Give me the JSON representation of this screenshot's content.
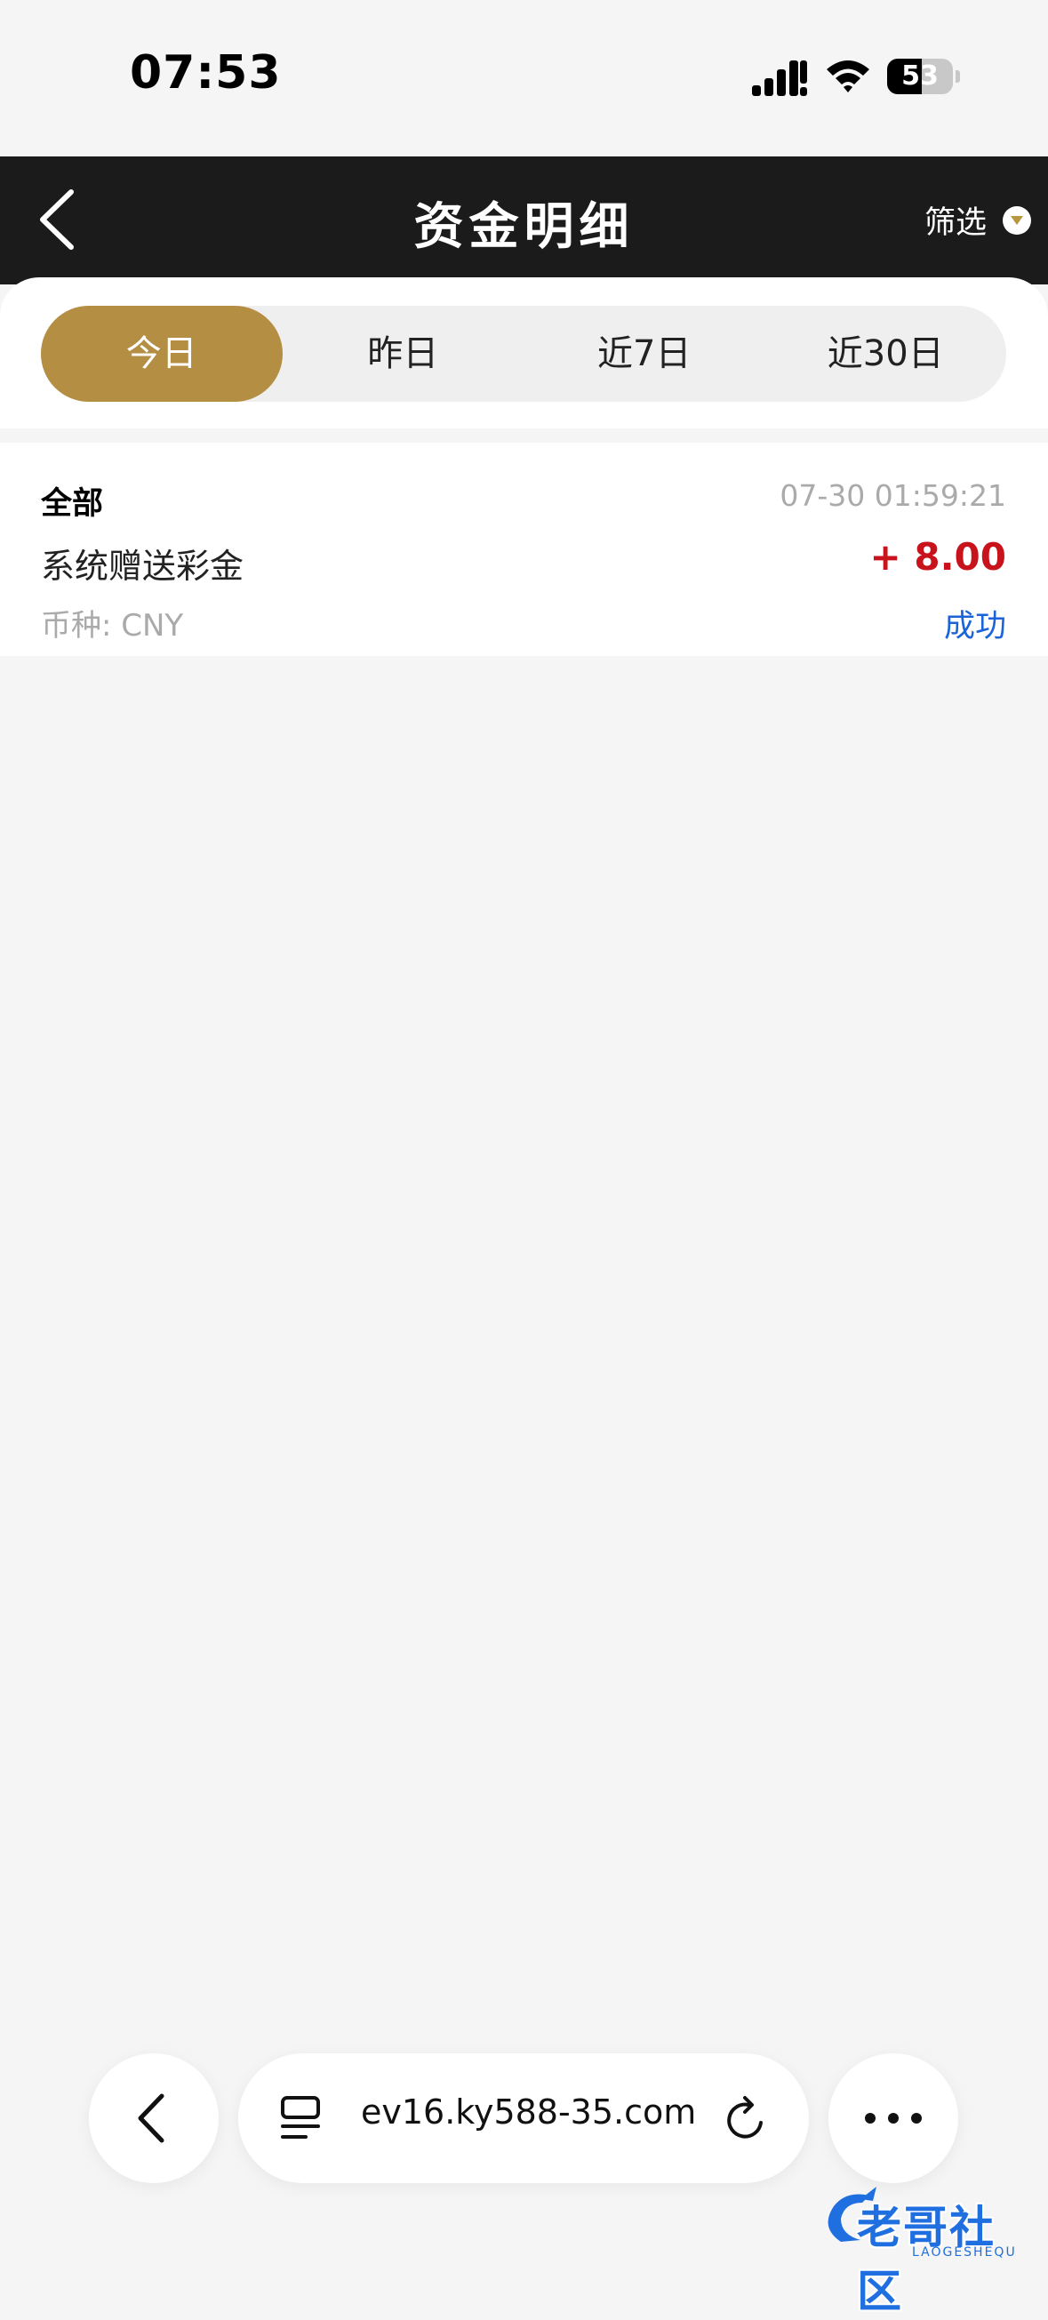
{
  "status_bar": {
    "time": "07:53",
    "battery_percent": "53",
    "battery_level": 0.53
  },
  "header": {
    "title": "资金明细",
    "filter_label": "筛选"
  },
  "tabs": [
    {
      "label": "今日",
      "active": true
    },
    {
      "label": "昨日",
      "active": false
    },
    {
      "label": "近7日",
      "active": false
    },
    {
      "label": "近30日",
      "active": false
    }
  ],
  "record": {
    "type": "全部",
    "time": "07-30 01:59:21",
    "description": "系统赠送彩金",
    "amount": "+ 8.00",
    "currency": "币种: CNY",
    "status": "成功"
  },
  "browser": {
    "url": "ev16.ky588-35.com"
  },
  "watermark": {
    "text": "老哥社区",
    "subtext": "LAOGESHEQU"
  },
  "colors": {
    "header_bg": "#1b1b1b",
    "accent_gold": "#b48e43",
    "amount_red": "#c8121c",
    "status_blue": "#1a63d8"
  }
}
